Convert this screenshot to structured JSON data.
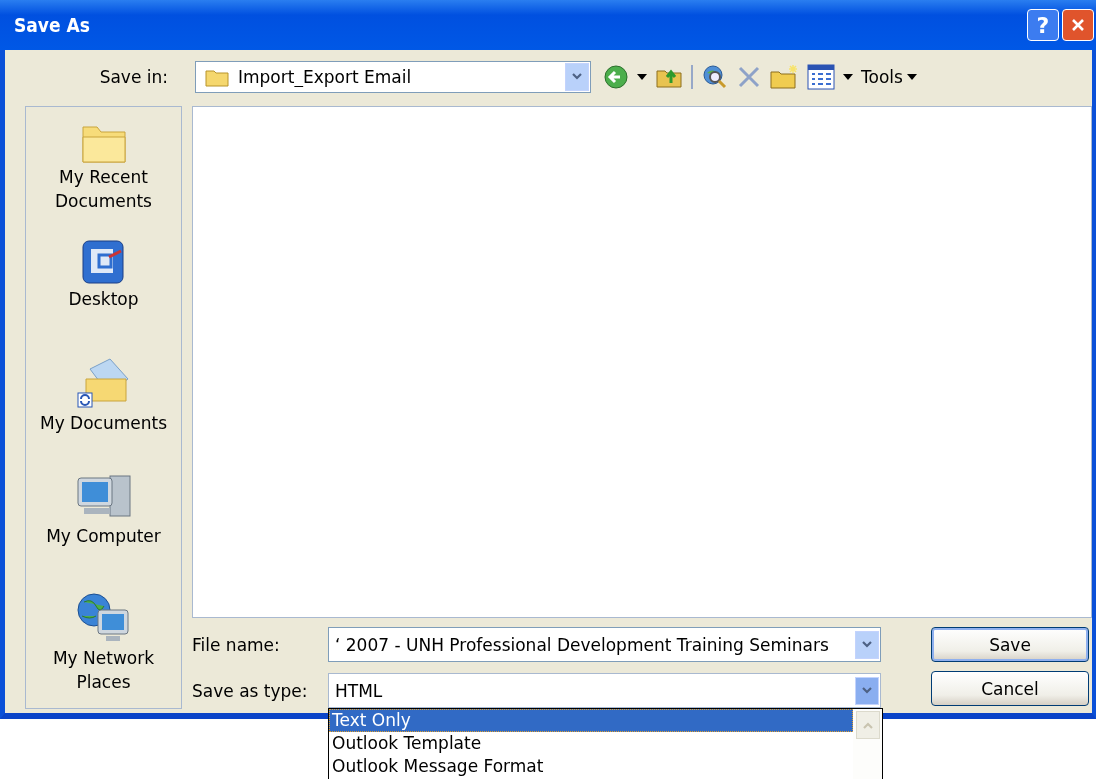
{
  "window": {
    "title": "Save As",
    "help_button": "?"
  },
  "save_in": {
    "label": "Save in:",
    "value": "Import_Export Email"
  },
  "toolbar": {
    "tools_label": "Tools"
  },
  "places": [
    {
      "label": "My Recent Documents",
      "kind": "recent"
    },
    {
      "label": "Desktop",
      "kind": "desktop"
    },
    {
      "label": "My Documents",
      "kind": "documents"
    },
    {
      "label": "My Computer",
      "kind": "computer"
    },
    {
      "label": "My Network Places",
      "kind": "network"
    }
  ],
  "file_name": {
    "label": "File name:",
    "value": "‘ 2007 - UNH Professional Development  Training Seminars"
  },
  "save_as_type": {
    "label": "Save as type:",
    "value": "HTML"
  },
  "type_options": [
    {
      "label": "Text Only",
      "selected": true
    },
    {
      "label": "Outlook Template",
      "selected": false
    },
    {
      "label": "Outlook Message Format",
      "selected": false
    }
  ],
  "buttons": {
    "save": "Save",
    "cancel": "Cancel"
  }
}
